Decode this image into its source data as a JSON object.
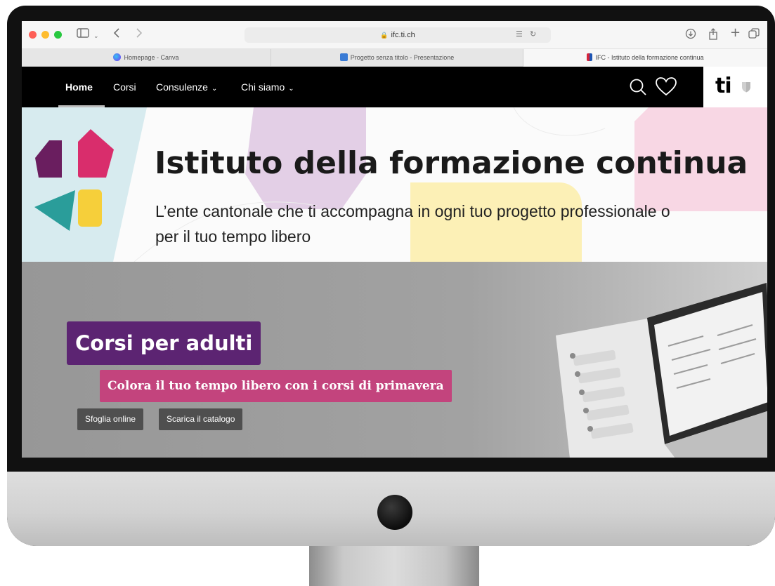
{
  "browser": {
    "address": "ifc.ti.ch",
    "tabs": [
      {
        "label": "Homepage - Canva"
      },
      {
        "label": "Progetto senza titolo - Presentazione"
      },
      {
        "label": "IFC - Istituto della formazione continua"
      }
    ]
  },
  "nav": {
    "items": [
      {
        "label": "Home",
        "active": true
      },
      {
        "label": "Corsi"
      },
      {
        "label": "Consulenze"
      },
      {
        "label": "Chi siamo"
      }
    ],
    "logo_text": "ti"
  },
  "hero": {
    "title": "Istituto della formazione continua",
    "subtitle": "L’ente cantonale che ti accompagna in ogni tuo progetto professionale o per il tuo tempo libero"
  },
  "banner": {
    "heading": "Corsi per adulti",
    "tagline": "Colora il tuo tempo libero con i corsi di primavera",
    "buttons": [
      {
        "label": "Sfoglia online"
      },
      {
        "label": "Scarica il catalogo"
      }
    ]
  },
  "colors": {
    "purple": "#5c2472",
    "pink": "#c3447d",
    "teal": "#2a9d9a",
    "yellow": "#f6cf3a",
    "magenta": "#d92d6c"
  },
  "icons": [
    "sidebar-icon",
    "back-icon",
    "forward-icon",
    "lock-icon",
    "translate-icon",
    "reload-icon",
    "download-icon",
    "share-icon",
    "new-tab-icon",
    "tabs-overview-icon",
    "search-icon",
    "heart-icon"
  ]
}
